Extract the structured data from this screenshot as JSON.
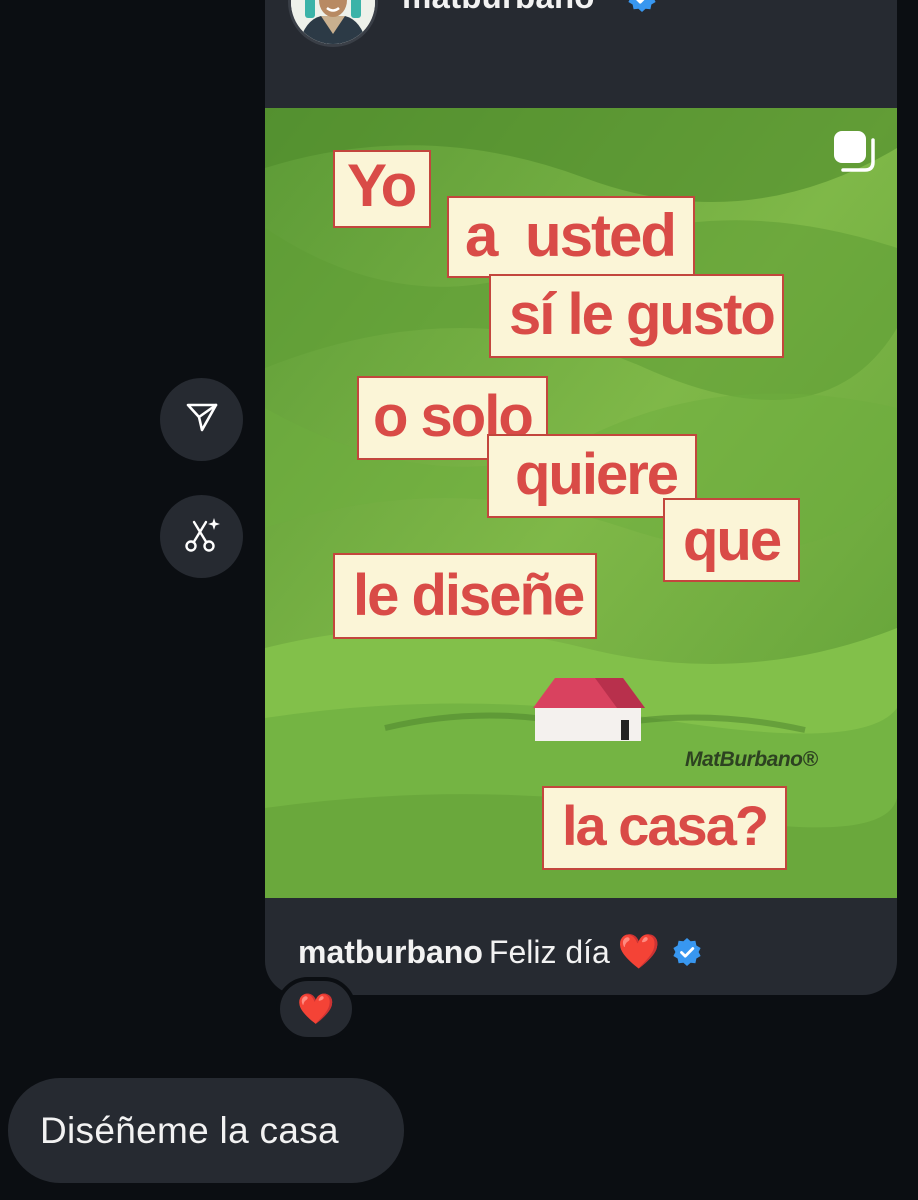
{
  "post": {
    "username": "matburbano",
    "verified": true,
    "badge_color": "#3897f0",
    "multi_post_icon": "carousel-icon",
    "image": {
      "phrases": [
        "Yo",
        "a  usted",
        "sí le gusto",
        "o solo",
        "quiere",
        "que",
        "le diseñe",
        "la casa?"
      ],
      "watermark": "MatBurbano®",
      "text_color": "#d94b47",
      "label_bg": "#fbf5d7"
    },
    "caption": {
      "username": "matburbano",
      "text": "Feliz día",
      "emoji": "❤️"
    }
  },
  "actions": {
    "share_icon": "send-icon",
    "remix_icon": "scissors-sparkle-icon"
  },
  "reaction": {
    "emoji": "❤️"
  },
  "reply": {
    "text": "Diséñeme la casa"
  }
}
